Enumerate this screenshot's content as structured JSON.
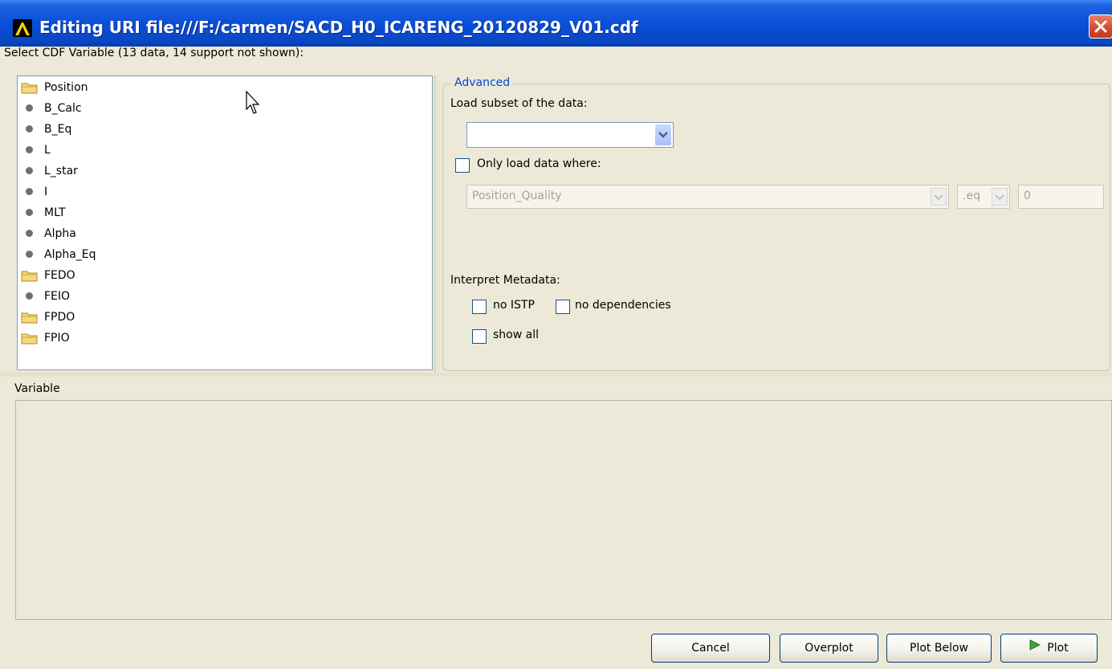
{
  "window": {
    "title": "Editing URI file:///F:/carmen/SACD_H0_ICARENG_20120829_V01.cdf",
    "app_icon": "autoplot-icon",
    "close_icon": "close-icon"
  },
  "select_label": "Select CDF Variable (13 data, 14 support not shown):",
  "tree": {
    "items": [
      {
        "label": "Position",
        "icon": "folder-icon"
      },
      {
        "label": "B_Calc",
        "icon": "leaf-dot-icon"
      },
      {
        "label": "B_Eq",
        "icon": "leaf-dot-icon"
      },
      {
        "label": "L",
        "icon": "leaf-dot-icon"
      },
      {
        "label": "L_star",
        "icon": "leaf-dot-icon"
      },
      {
        "label": "I",
        "icon": "leaf-dot-icon"
      },
      {
        "label": "MLT",
        "icon": "leaf-dot-icon"
      },
      {
        "label": "Alpha",
        "icon": "leaf-dot-icon"
      },
      {
        "label": "Alpha_Eq",
        "icon": "leaf-dot-icon"
      },
      {
        "label": "FEDO",
        "icon": "folder-icon"
      },
      {
        "label": "FEIO",
        "icon": "leaf-dot-icon"
      },
      {
        "label": "FPDO",
        "icon": "folder-icon"
      },
      {
        "label": "FPIO",
        "icon": "folder-icon"
      }
    ]
  },
  "advanced": {
    "legend": "Advanced",
    "load_subset_label": "Load subset of the data:",
    "subset_value": "",
    "only_load_label": "Only load data where:",
    "where_variable": "Position_Quality",
    "where_operator": ".eq",
    "where_value": "0",
    "interpret_label": "Interpret Metadata:",
    "no_istp_label": "no ISTP",
    "no_dependencies_label": "no dependencies",
    "show_all_label": "show all"
  },
  "variable_label": "Variable",
  "buttons": {
    "cancel": "Cancel",
    "overplot": "Overplot",
    "plot_below": "Plot Below",
    "plot": "Plot"
  },
  "colors": {
    "titlebar": "#0a4fd8",
    "window_bg": "#ece9d8",
    "legend_text": "#0046d5",
    "plot_arrow": "#3aa53a"
  }
}
